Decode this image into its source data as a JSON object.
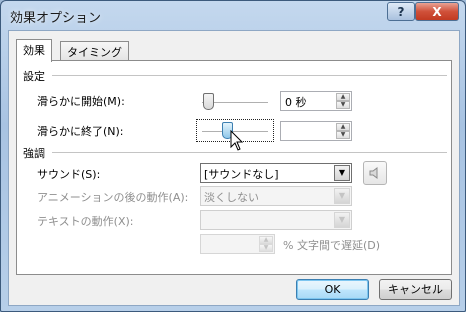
{
  "window": {
    "title": "効果オプション"
  },
  "title_buttons": {
    "help": "?",
    "close": "X"
  },
  "tabs": [
    {
      "label": "効果",
      "active": true
    },
    {
      "label": "タイミング",
      "active": false
    }
  ],
  "settings": {
    "section_label": "設定",
    "start_smoothly": {
      "label": "滑らかに開始(M):",
      "value": "0 秒",
      "slider_level": 0.0
    },
    "end_smoothly": {
      "label": "滑らかに終了(N):",
      "value": "",
      "slider_level": 0.45
    }
  },
  "enhancements": {
    "section_label": "強調",
    "sound": {
      "label": "サウンド(S):",
      "value": "[サウンドなし]"
    },
    "after_animation": {
      "label": "アニメーションの後の動作(A):",
      "value": "淡くしない"
    },
    "animate_text": {
      "label": "テキストの動作(X):",
      "value": ""
    },
    "delay_between_letters": {
      "value": "",
      "suffix": "% 文字間で遅延(D)"
    }
  },
  "buttons": {
    "ok": "OK",
    "cancel": "キャンセル"
  },
  "icons": {
    "spin_up": "up-arrow",
    "spin_down": "down-arrow",
    "combo": "dropdown-arrow",
    "sound": "speaker-icon",
    "cursor": "mouse-pointer"
  },
  "colors": {
    "close_button": "#c23a22",
    "default_button_border": "#3c7fb1"
  }
}
